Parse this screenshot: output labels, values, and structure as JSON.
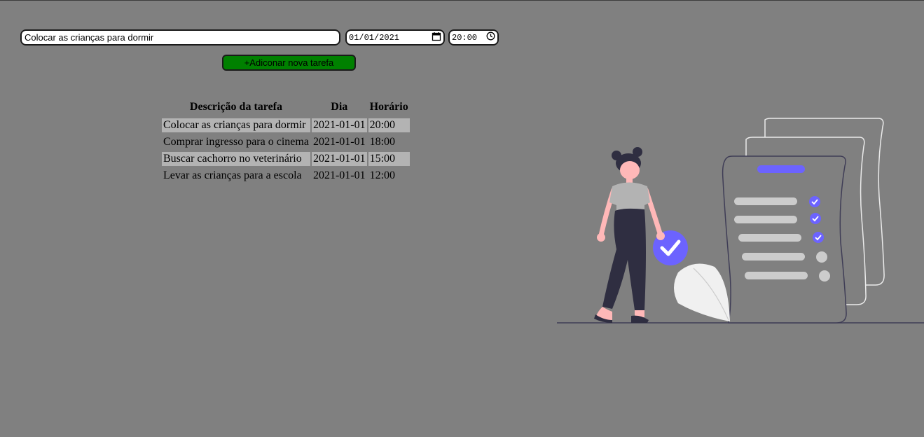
{
  "form": {
    "task_value": "Colocar as crianças para dormir",
    "date_value": "01/01/2021",
    "time_value": "20:00",
    "add_button_label": "+Adiconar nova tarefa"
  },
  "table": {
    "headers": {
      "description": "Descrição da tarefa",
      "day": "Dia",
      "time": "Horário"
    },
    "rows": [
      {
        "description": "Colocar as crianças para dormir",
        "day": "2021-01-01",
        "time": "20:00"
      },
      {
        "description": "Comprar ingresso para o cinema",
        "day": "2021-01-01",
        "time": "18:00"
      },
      {
        "description": "Buscar cachorro no veterinário",
        "day": "2021-01-01",
        "time": "15:00"
      },
      {
        "description": "Levar as crianças para a escola",
        "day": "2021-01-01",
        "time": "12:00"
      }
    ]
  },
  "colors": {
    "background": "#808080",
    "accent": "#6c63ff",
    "button": "#008000",
    "row_stripe": "#b3b3b3"
  },
  "icons": {
    "date_picker": "calendar-icon",
    "time_picker": "clock-icon",
    "illustration": "todo-list-woman-illustration"
  }
}
